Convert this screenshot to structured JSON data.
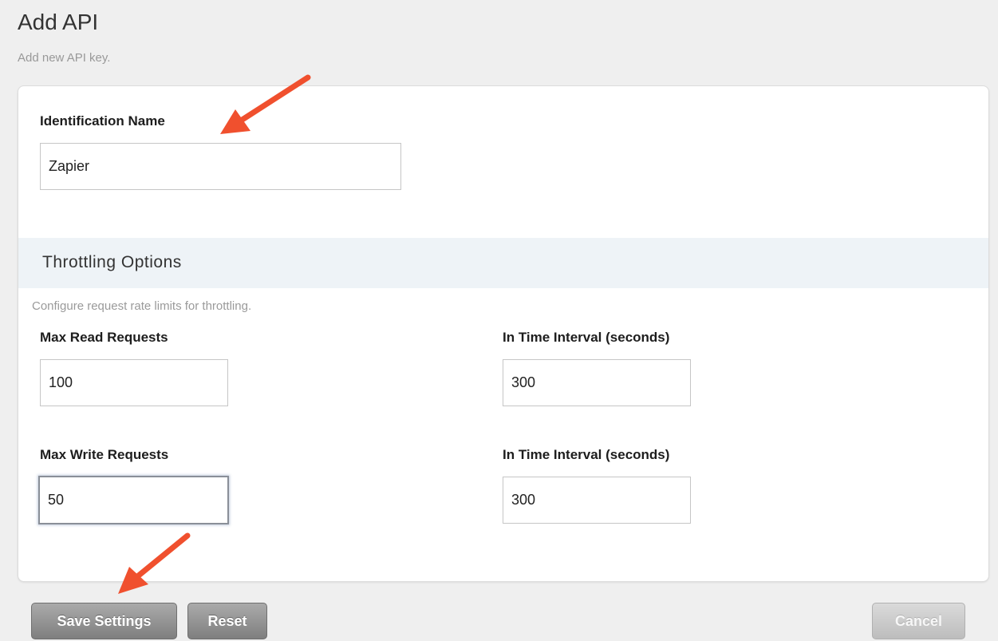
{
  "header": {
    "title": "Add API",
    "subtitle": "Add new API key."
  },
  "identification": {
    "label": "Identification Name",
    "value": "Zapier"
  },
  "throttling": {
    "title": "Throttling Options",
    "description": "Configure request rate limits for throttling.",
    "max_read_label": "Max Read Requests",
    "max_read_value": "100",
    "read_interval_label": "In Time Interval (seconds)",
    "read_interval_value": "300",
    "max_write_label": "Max Write Requests",
    "max_write_value": "50",
    "write_interval_label": "In Time Interval (seconds)",
    "write_interval_value": "300"
  },
  "actions": {
    "save_label": "Save Settings",
    "reset_label": "Reset",
    "cancel_label": "Cancel"
  },
  "colors": {
    "annotation_arrow": "#f0502e",
    "section_header_bg": "#eef3f7",
    "button_gray": "#8f8f8f",
    "cancel_gray": "#c9c9c9"
  },
  "icons": {
    "annotation": "arrow-icon"
  }
}
